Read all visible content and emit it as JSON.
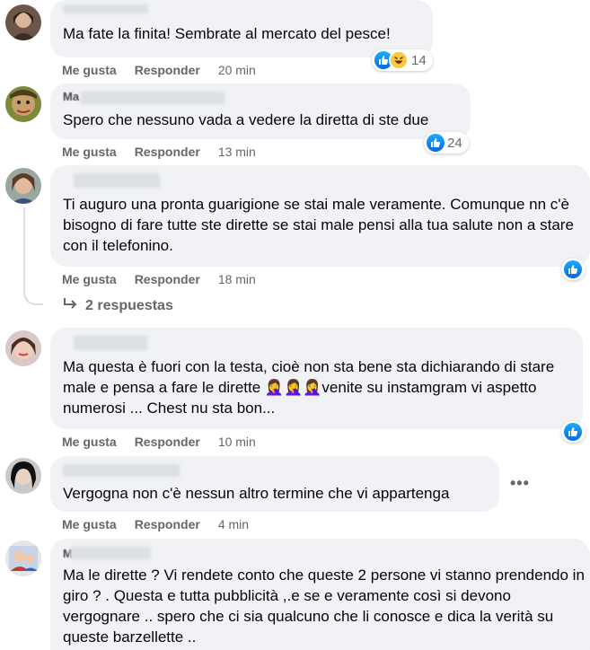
{
  "ui": {
    "like_label": "Me gusta",
    "reply_label": "Responder",
    "replies_label": "2 respuestas",
    "more_label": "•••",
    "colors": {
      "bubble": "#f0f2f5",
      "meta": "#65676b",
      "like": "#1877f2",
      "haha": "#f7c93d"
    }
  },
  "comments": [
    {
      "name_visible": "",
      "text": "Ma fate la finita! Sembrate al mercato del pesce!",
      "time": "20 min",
      "reaction_count": "14",
      "reaction_icons": [
        "like-icon",
        "haha-icon"
      ]
    },
    {
      "name_visible": "Ma",
      "text": "Spero che nessuno vada a vedere la diretta di ste due",
      "time": "13 min",
      "reaction_count": "24",
      "reaction_icons": [
        "like-icon"
      ]
    },
    {
      "name_visible": "",
      "text": "Ti auguro una pronta guarigione se stai male veramente. Comunque nn c'è bisogno di fare tutte ste dirette se stai male pensi alla tua salute non a stare con il telefonino.",
      "time": "18 min",
      "reaction_count": "",
      "reaction_icons": [
        "like-icon"
      ]
    },
    {
      "name_visible": "",
      "text": "Ma questa è fuori con la testa, cioè non sta bene sta dichiarando di stare male e pensa a fare le dirette 🤦‍♀️🤦‍♀️🤦‍♀️venite su instamgram vi aspetto numerosi ... Chest nu sta bon...",
      "time": "10 min",
      "reaction_count": "",
      "reaction_icons": [
        "like-icon"
      ]
    },
    {
      "name_visible": "",
      "text": "Vergogna non c'è nessun altro termine che vi appartenga",
      "time": "4 min",
      "reaction_count": "",
      "reaction_icons": []
    },
    {
      "name_visible": "M",
      "text": "Ma le dirette ? Vi rendete conto che queste 2 persone vi stanno prendendo in giro ? . Questa e tutta pubblicità ,.e se e veramente così si devono vergognare .. spero che ci sia qualcuno che li conosce e dica la verità su queste barzellette ..",
      "time": "",
      "reaction_count": "",
      "reaction_icons": []
    }
  ]
}
